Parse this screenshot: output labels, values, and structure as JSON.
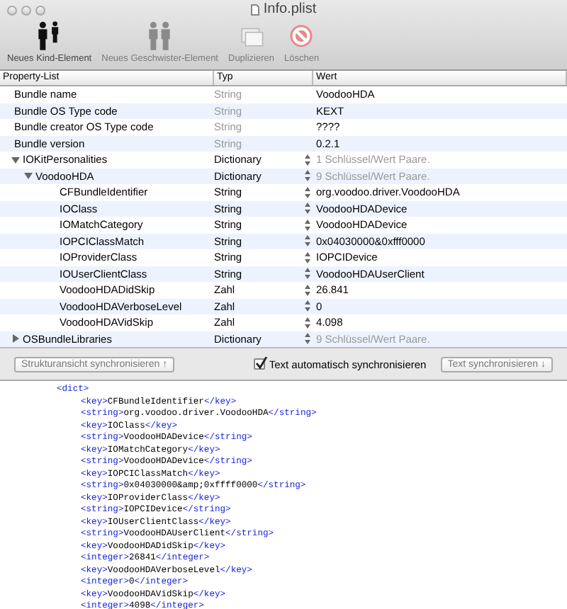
{
  "window": {
    "title": "Info.plist"
  },
  "toolbar": [
    {
      "kind": "child",
      "label": "Neues Kind-Element",
      "disabled": false
    },
    {
      "kind": "sibling",
      "label": "Neues Geschwister-Element",
      "disabled": true
    },
    {
      "kind": "duplicate",
      "label": "Duplizieren",
      "disabled": true
    },
    {
      "kind": "delete",
      "label": "Löschen",
      "disabled": true
    }
  ],
  "table": {
    "columns": [
      "Property-List",
      "Typ",
      "Wert"
    ],
    "rows": [
      {
        "key": "Bundle name",
        "type": "String",
        "value": "VoodooHDA",
        "type_dimmed": true,
        "value_dimmed": false,
        "stepper": false
      },
      {
        "key": "Bundle OS Type code",
        "type": "String",
        "value": "KEXT",
        "type_dimmed": true,
        "value_dimmed": false,
        "stepper": false
      },
      {
        "key": "Bundle creator OS Type code",
        "type": "String",
        "value": "????",
        "type_dimmed": true,
        "value_dimmed": false,
        "stepper": false
      },
      {
        "key": "Bundle version",
        "type": "String",
        "value": "0.2.1",
        "type_dimmed": true,
        "value_dimmed": false,
        "stepper": false
      },
      {
        "key": "IOKitPersonalities",
        "type": "Dictionary",
        "value": "1 Schlüssel/Wert Paare.",
        "type_dimmed": false,
        "value_dimmed": true,
        "stepper": true,
        "expanded": true,
        "children": [
          {
            "key": "VoodooHDA",
            "type": "Dictionary",
            "value": "9 Schlüssel/Wert Paare.",
            "type_dimmed": false,
            "value_dimmed": true,
            "stepper": true,
            "expanded": true,
            "children": [
              {
                "key": "CFBundleIdentifier",
                "type": "String",
                "value": "org.voodoo.driver.VoodooHDA",
                "type_dimmed": false,
                "value_dimmed": false,
                "stepper": true
              },
              {
                "key": "IOClass",
                "type": "String",
                "value": "VoodooHDADevice",
                "type_dimmed": false,
                "value_dimmed": false,
                "stepper": true
              },
              {
                "key": "IOMatchCategory",
                "type": "String",
                "value": "VoodooHDADevice",
                "type_dimmed": false,
                "value_dimmed": false,
                "stepper": true
              },
              {
                "key": "IOPCIClassMatch",
                "type": "String",
                "value": "0x04030000&0xfff0000",
                "type_dimmed": false,
                "value_dimmed": false,
                "stepper": true
              },
              {
                "key": "IOProviderClass",
                "type": "String",
                "value": "IOPCIDevice",
                "type_dimmed": false,
                "value_dimmed": false,
                "stepper": true
              },
              {
                "key": "IOUserClientClass",
                "type": "String",
                "value": "VoodooHDAUserClient",
                "type_dimmed": false,
                "value_dimmed": false,
                "stepper": true
              },
              {
                "key": "VoodooHDADidSkip",
                "type": "Zahl",
                "value": "26.841",
                "type_dimmed": false,
                "value_dimmed": false,
                "stepper": true
              },
              {
                "key": "VoodooHDAVerboseLevel",
                "type": "Zahl",
                "value": "0",
                "type_dimmed": false,
                "value_dimmed": false,
                "stepper": true
              },
              {
                "key": "VoodooHDAVidSkip",
                "type": "Zahl",
                "value": "4.098",
                "type_dimmed": false,
                "value_dimmed": false,
                "stepper": true
              }
            ]
          }
        ]
      },
      {
        "key": "OSBundleLibraries",
        "type": "Dictionary",
        "value": "9 Schlüssel/Wert Paare.",
        "type_dimmed": false,
        "value_dimmed": true,
        "stepper": true,
        "expanded": false
      }
    ]
  },
  "sync_bar": {
    "structure_button": {
      "label": "Strukturansicht synchronisieren ↑",
      "disabled": true
    },
    "auto_sync": {
      "label": "Text automatisch synchronisieren",
      "checked": true
    },
    "text_button": {
      "label": "Text synchronisieren ↓",
      "disabled": true
    }
  },
  "xml": [
    {
      "open": "<dict>",
      "children": [
        {
          "open": "<key>",
          "text": "CFBundleIdentifier",
          "close": "</key>"
        },
        {
          "open": "<string>",
          "text": "org.voodoo.driver.VoodooHDA",
          "close": "</string>"
        },
        {
          "open": "<key>",
          "text": "IOClass",
          "close": "</key>"
        },
        {
          "open": "<string>",
          "text": "VoodooHDADevice",
          "close": "</string>"
        },
        {
          "open": "<key>",
          "text": "IOMatchCategory",
          "close": "</key>"
        },
        {
          "open": "<string>",
          "text": "VoodooHDADevice",
          "close": "</string>"
        },
        {
          "open": "<key>",
          "text": "IOPCIClassMatch",
          "close": "</key>"
        },
        {
          "open": "<string>",
          "text": "0x04030000&amp;0xffff0000",
          "close": "</string>"
        },
        {
          "open": "<key>",
          "text": "IOProviderClass",
          "close": "</key>"
        },
        {
          "open": "<string>",
          "text": "IOPCIDevice",
          "close": "</string>"
        },
        {
          "open": "<key>",
          "text": "IOUserClientClass",
          "close": "</key>"
        },
        {
          "open": "<string>",
          "text": "VoodooHDAUserClient",
          "close": "</string>"
        },
        {
          "open": "<key>",
          "text": "VoodooHDADidSkip",
          "close": "</key>"
        },
        {
          "open": "<integer>",
          "text": "26841",
          "close": "</integer>"
        },
        {
          "open": "<key>",
          "text": "VoodooHDAVerboseLevel",
          "close": "</key>"
        },
        {
          "open": "<integer>",
          "text": "0",
          "close": "</integer>"
        },
        {
          "open": "<key>",
          "text": "VoodooHDAVidSkip",
          "close": "</key>"
        },
        {
          "open": "<integer>",
          "text": "4098",
          "close": "</integer>"
        }
      ]
    }
  ]
}
